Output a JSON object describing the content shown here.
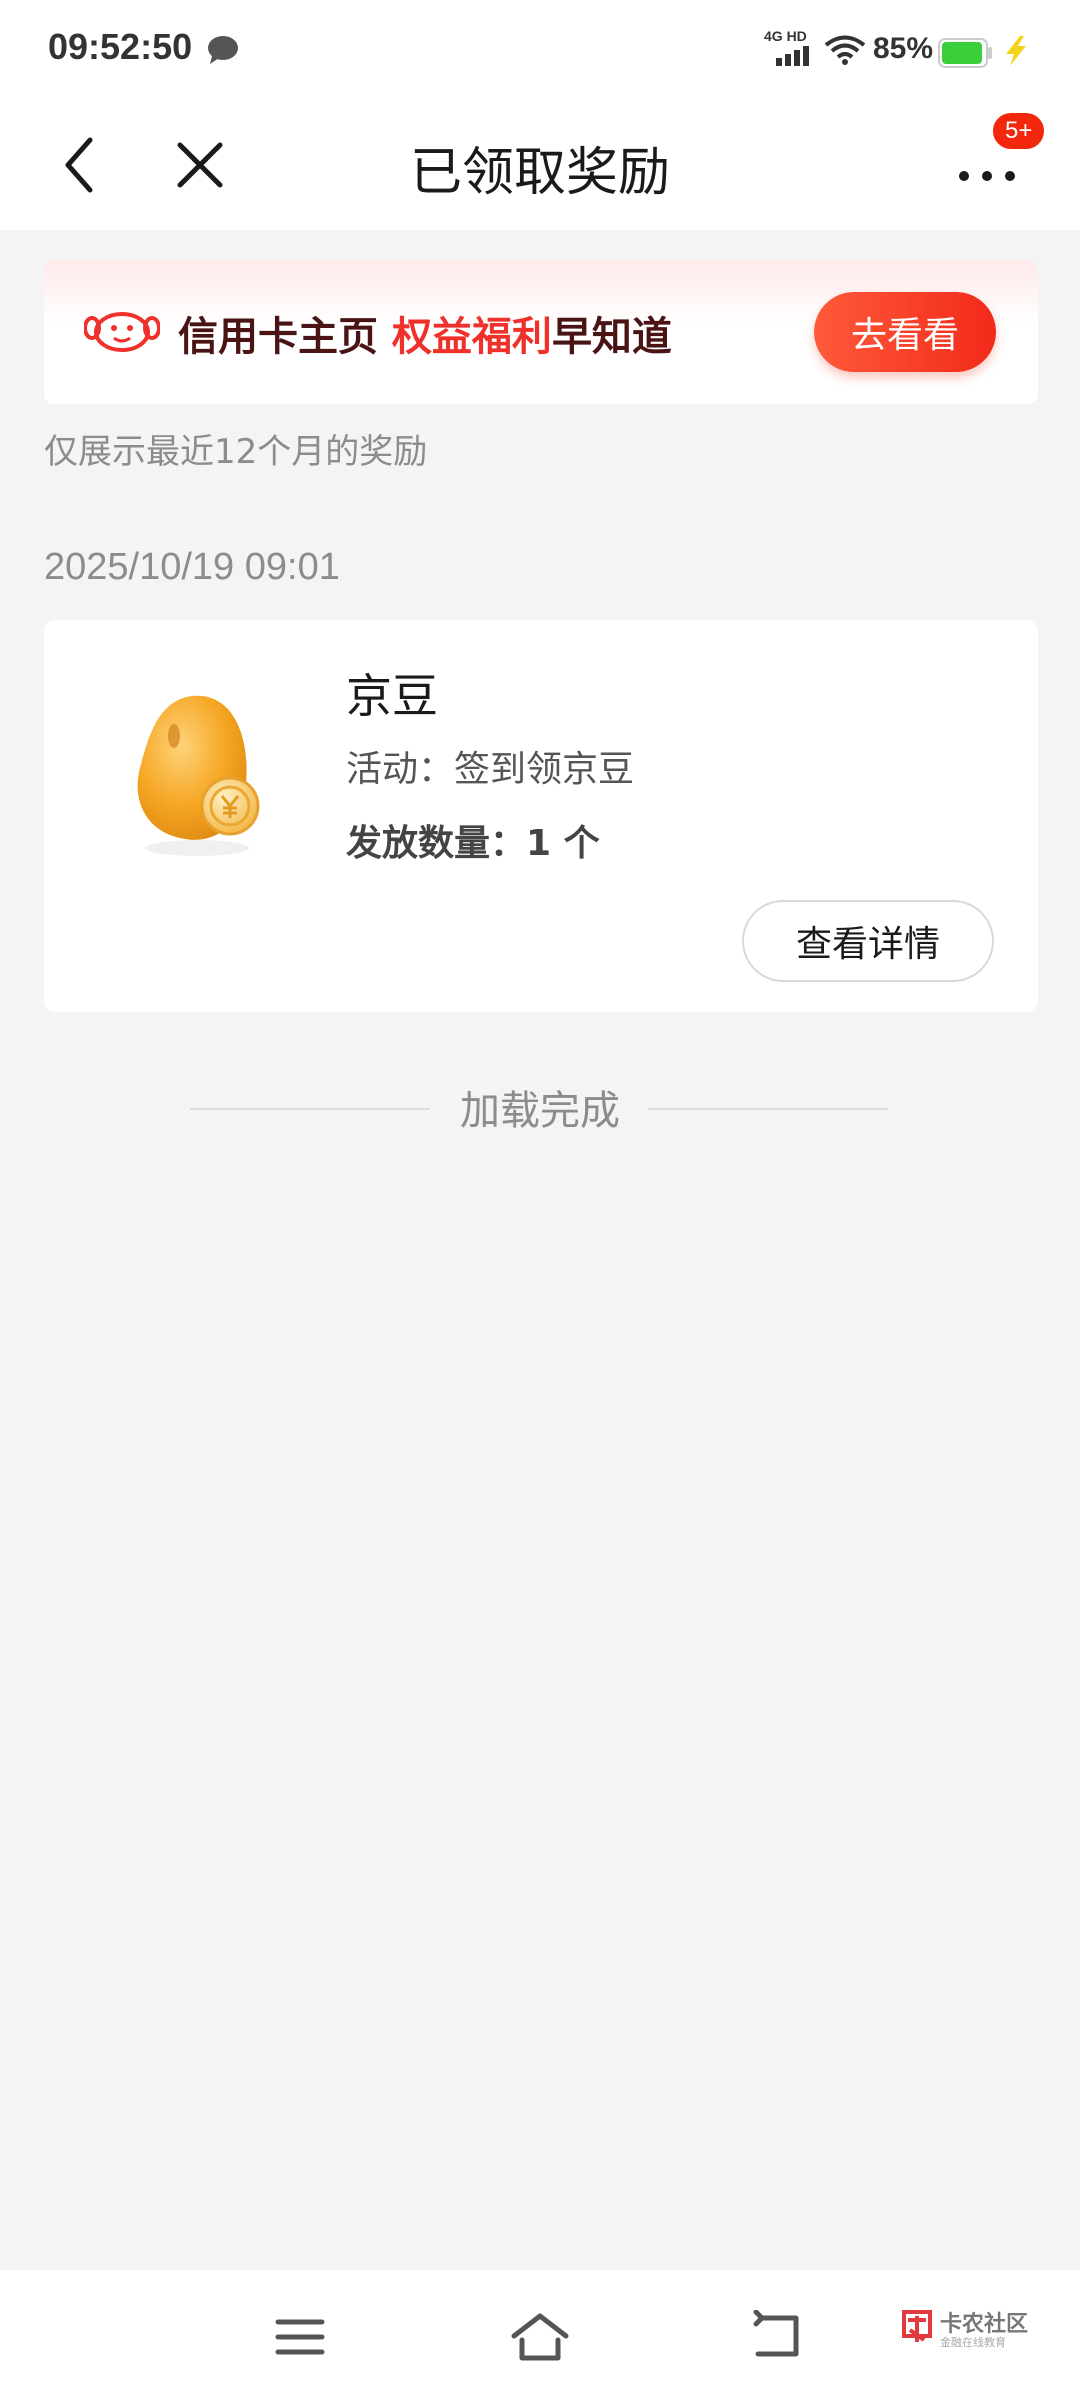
{
  "status_bar": {
    "time": "09:52:50",
    "network": "4G HD",
    "battery": "85%"
  },
  "nav": {
    "title": "已领取奖励",
    "badge": "5+"
  },
  "banner": {
    "text_part1": "信用卡主页 ",
    "text_highlight": "权益福利",
    "text_part2": "早知道",
    "button": "去看看"
  },
  "hint": "仅展示最近12个月的奖励",
  "date": "2025/10/19 09:01",
  "reward": {
    "title": "京豆",
    "activity": "活动：签到领京豆",
    "quantity": "发放数量：1 个",
    "button": "查看详情"
  },
  "footer_status": "加载完成",
  "watermark": {
    "title": "卡农社区",
    "subtitle": "金融在线教育"
  },
  "colors": {
    "accent_red": "#f2270c",
    "banner_button": "#f22a1a",
    "battery_green": "#3ccf3c",
    "background": "#f4f4f4"
  }
}
